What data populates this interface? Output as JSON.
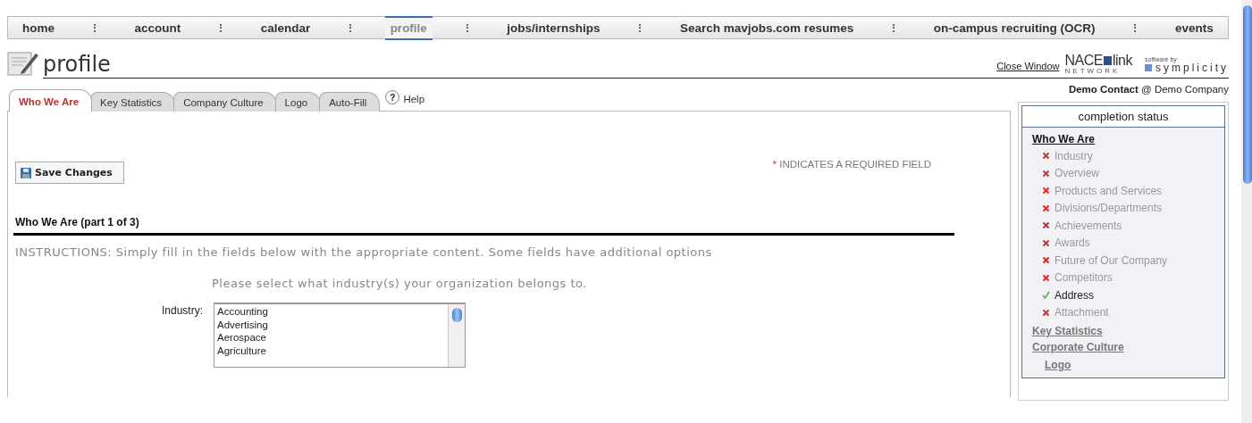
{
  "nav": [
    {
      "label": "home",
      "selected": false
    },
    {
      "label": "account",
      "selected": false
    },
    {
      "label": "calendar",
      "selected": false
    },
    {
      "label": "profile",
      "selected": true
    },
    {
      "label": "jobs/internships",
      "selected": false
    },
    {
      "label": "Search mavjobs.com resumes",
      "selected": false
    },
    {
      "label": "on-campus recruiting (OCR)",
      "selected": false
    },
    {
      "label": "events",
      "selected": false
    }
  ],
  "header": {
    "title": "profile",
    "close_link": "Close Window",
    "nace_logo": {
      "main": "NACE",
      "link": "link",
      "sub": "NETWORK"
    },
    "symplicity_logo": {
      "tagline": "software by",
      "name": "symplicity"
    }
  },
  "user": {
    "name": "Demo Contact",
    "separator": "@",
    "company": "Demo Company"
  },
  "tabs": [
    {
      "label": "Who We Are",
      "selected": true
    },
    {
      "label": "Key Statistics",
      "selected": false
    },
    {
      "label": "Company Culture",
      "selected": false
    },
    {
      "label": "Logo",
      "selected": false
    },
    {
      "label": "Auto-Fill",
      "selected": false
    }
  ],
  "help": {
    "icon": "?",
    "label": "Help"
  },
  "form": {
    "save_button": "Save Changes",
    "required_mark": "*",
    "required_note": "INDICATES A REQUIRED FIELD",
    "section_title": "Who We Are (part 1 of 3)",
    "instructions": "INSTRUCTIONS: Simply fill in the fields below with the appropriate content. Some fields have additional options",
    "prompt": "Please select what industry(s) your organization belongs to.",
    "industry_label": "Industry:",
    "industry_options": [
      "Accounting",
      "Advertising",
      "Aerospace",
      "Agriculture"
    ]
  },
  "completion": {
    "title": "completion status",
    "sections": [
      {
        "label": "Who We Are",
        "items": [
          {
            "label": "Industry",
            "complete": false
          },
          {
            "label": "Overview",
            "complete": false
          },
          {
            "label": "Products and Services",
            "complete": false
          },
          {
            "label": "Divisions/Departments",
            "complete": false
          },
          {
            "label": "Achievements",
            "complete": false
          },
          {
            "label": "Awards",
            "complete": false
          },
          {
            "label": "Future of Our Company",
            "complete": false
          },
          {
            "label": "Competitors",
            "complete": false
          },
          {
            "label": "Address",
            "complete": true
          },
          {
            "label": "Attachment",
            "complete": false
          }
        ]
      },
      {
        "label": "Key Statistics"
      },
      {
        "label": "Corporate Culture"
      },
      {
        "label": "Logo"
      }
    ]
  }
}
